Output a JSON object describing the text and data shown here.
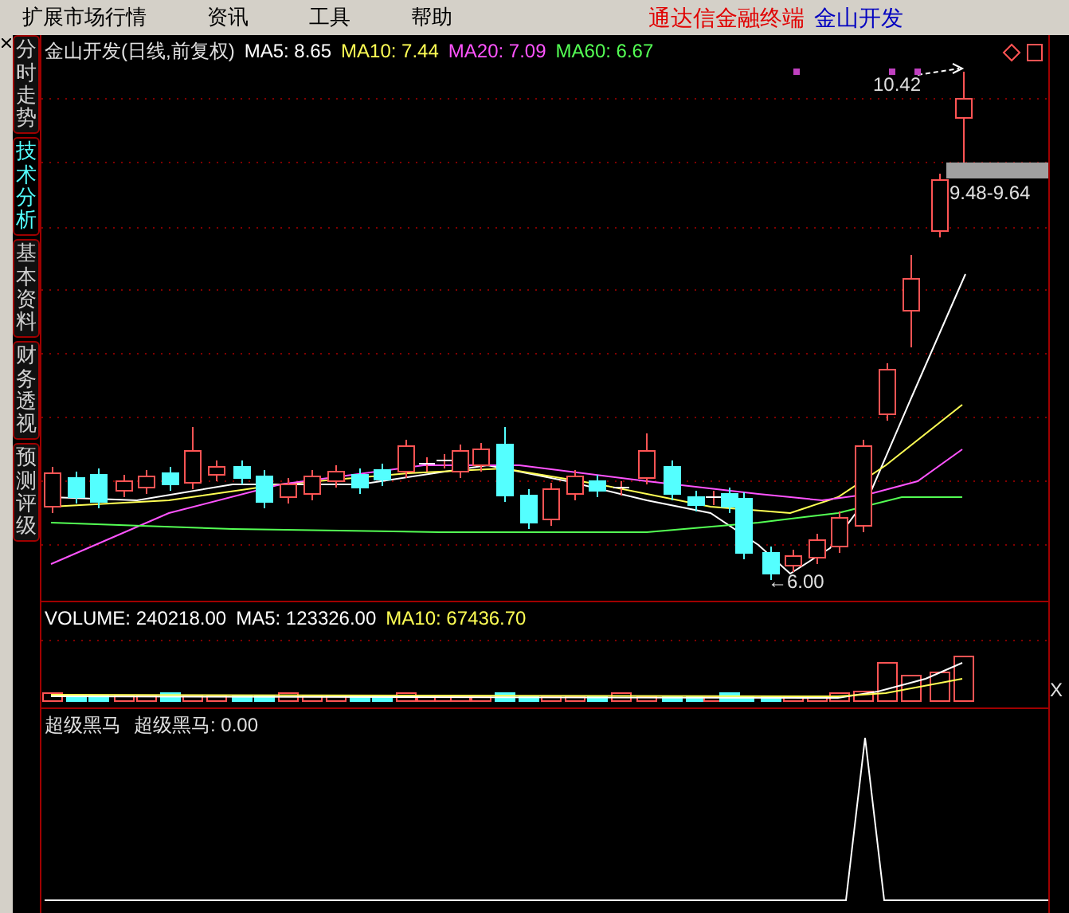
{
  "menu": {
    "items": [
      "扩展市场行情",
      "资讯",
      "工具",
      "帮助"
    ],
    "product": "通达信金融终端",
    "stock": "金山开发"
  },
  "side_tabs": [
    {
      "label": "分时走势",
      "selected": false
    },
    {
      "label": "技术分析",
      "selected": true
    },
    {
      "label": "基本资料",
      "selected": false
    },
    {
      "label": "财务透视",
      "selected": false
    },
    {
      "label": "预测评级",
      "selected": false
    }
  ],
  "price_panel": {
    "title": "金山开发(日线,前复权)",
    "readouts": [
      {
        "label": "MA5: 8.65",
        "color": "#ffffff"
      },
      {
        "label": "MA10: 7.44",
        "color": "#ffff54"
      },
      {
        "label": "MA20: 7.09",
        "color": "#ff54ff"
      },
      {
        "label": "MA60: 6.67",
        "color": "#54ff54"
      }
    ],
    "high_label": "10.42",
    "range_label": "9.48-9.64",
    "low_label": "←6.00"
  },
  "volume_panel": {
    "readouts": [
      {
        "label": "VOLUME: 240218.00",
        "color": "#ffffff"
      },
      {
        "label": "MA5: 123326.00",
        "color": "#ffffff"
      },
      {
        "label": "MA10: 67436.70",
        "color": "#ffff54"
      }
    ]
  },
  "indicator_panel": {
    "name": "超级黑马",
    "readout": "超级黑马: 0.00"
  },
  "right_strip": {
    "label": "X"
  }
}
